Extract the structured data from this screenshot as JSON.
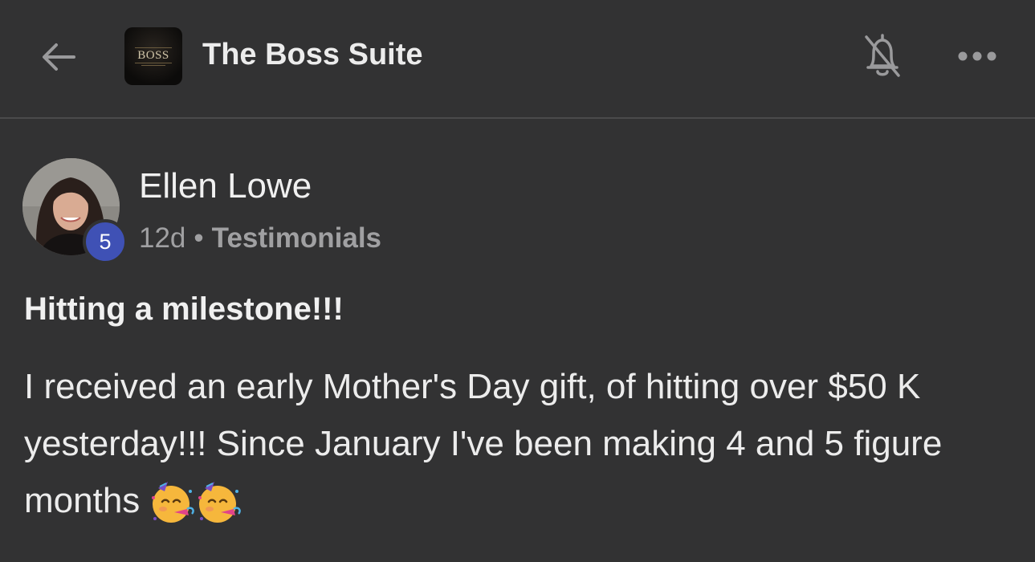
{
  "header": {
    "group_title": "The Boss Suite",
    "logo_text": "BOSS",
    "icons": {
      "back": "back-arrow-icon",
      "notifications": "bell-off-icon",
      "more": "more-horizontal-icon"
    }
  },
  "post": {
    "author": {
      "name": "Ellen Lowe",
      "level": "5"
    },
    "time_ago": "12d",
    "separator": "•",
    "category": "Testimonials",
    "title": "Hitting a milestone!!!",
    "body_lines": [
      "I received an early Mother's Day gift, of hitting over $50 K",
      "yesterday!!! Since January I've been making 4 and 5 figure",
      "months"
    ],
    "trailing_emoji": "partying-face-emoji x2"
  },
  "colors": {
    "background": "#323233",
    "divider": "#4a4a4b",
    "level_badge": "#3f51b5",
    "meta_text": "#a0a0a2"
  }
}
